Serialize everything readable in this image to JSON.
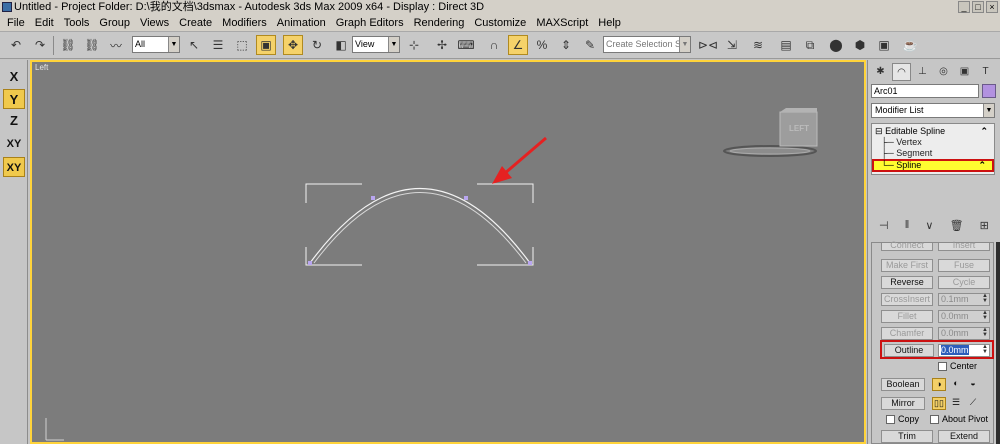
{
  "window": {
    "title": "Untitled    - Project Folder: D:\\我的文档\\3dsmax    - Autodesk 3ds Max  2009 x64      - Display : Direct 3D"
  },
  "menu": {
    "items": [
      "File",
      "Edit",
      "Tools",
      "Group",
      "Views",
      "Create",
      "Modifiers",
      "Animation",
      "Graph Editors",
      "Rendering",
      "Customize",
      "MAXScript",
      "Help"
    ]
  },
  "toolbar": {
    "filter_value": "All",
    "refcoord_value": "View",
    "selection_set_placeholder": "Create Selection Set"
  },
  "axis": {
    "x": "X",
    "y": "Y",
    "z": "Z",
    "xy": "XY",
    "xy2": "XY"
  },
  "viewport": {
    "label": "Left",
    "cube_label": "LEFT",
    "colors": {
      "background": "#7c7c7c",
      "active_border": "#ffd33a",
      "arrow": "#e52121",
      "vertex": "#b9a6f0"
    }
  },
  "command_panel": {
    "object_name": "Arc01",
    "object_color": "#b292e0",
    "modifier_list": "Modifier List",
    "stack": {
      "root": "Editable Spline",
      "vertex": "Vertex",
      "segment": "Segment",
      "spline": "Spline"
    },
    "rollout": {
      "connect": "Connect",
      "insert": "Insert",
      "make_first": "Make First",
      "fuse": "Fuse",
      "reverse": "Reverse",
      "cycle": "Cycle",
      "crossinsert": "CrossInsert",
      "crossinsert_value": "0.1mm",
      "fillet": "Fillet",
      "fillet_value": "0.0mm",
      "chamfer": "Chamfer",
      "chamfer_value": "0.0mm",
      "outline": "Outline",
      "outline_value": "0.0mm",
      "center": "Center",
      "boolean": "Boolean",
      "mirror": "Mirror",
      "copy": "Copy",
      "about_pivot": "About Pivot",
      "trim": "Trim",
      "extend": "Extend"
    }
  }
}
